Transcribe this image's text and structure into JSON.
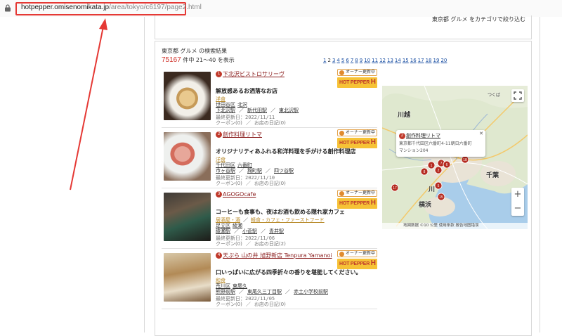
{
  "url": {
    "host": "hotpepper.omisenomikata.jp",
    "path": "/area/tokyo/c6197/page2.html"
  },
  "refine": {
    "text": "東京都 グルメ をカテゴリで絞り込む"
  },
  "results": {
    "title": "東京都 グルメ の検索結果",
    "total": "75167",
    "range_text": "件中 21〜40 を表示",
    "pager": [
      "1",
      "2",
      "3",
      "4",
      "5",
      "6",
      "7",
      "8",
      "9",
      "10",
      "11",
      "12",
      "13",
      "14",
      "15",
      "16",
      "17",
      "18",
      "19",
      "20"
    ],
    "current_page": "2"
  },
  "owner_badge": "オーナー更新中",
  "hp_logo": {
    "text": "HOT PEPPER",
    "mark": "H"
  },
  "items": [
    {
      "num": "1",
      "name": "下北沢ビストロサリーヴ",
      "catch": "解放感あるお洒落なお店",
      "genres": [
        "洋食"
      ],
      "area": [
        "世田谷区",
        "北沢"
      ],
      "stations": [
        "下北沢駅",
        "新代田駅",
        "東北沢駅"
      ],
      "updated": "最終更新日：2022/11/11",
      "coupon": "クーポン(0)",
      "diary": "お店の日記(0)"
    },
    {
      "num": "2",
      "name": "創作料理リトマ",
      "catch": "オリジナリティあふれる和洋料理を手がける創作料理店",
      "genres": [
        "洋食"
      ],
      "area": [
        "千代田区",
        "六番町"
      ],
      "stations": [
        "市ヶ谷駅",
        "麹町駅",
        "四ツ谷駅"
      ],
      "updated": "最終更新日：2022/11/10",
      "coupon": "クーポン(0)",
      "diary": "お店の日記(0)"
    },
    {
      "num": "3",
      "name": "AGOGOcafe",
      "catch": "コーヒーも食事も、夜はお酒も飲める隠れ家カフェ",
      "genres": [
        "居酒屋・酒",
        "軽食・カフェ・ファーストフード"
      ],
      "area": [
        "足立区",
        "綾瀬"
      ],
      "stations": [
        "綾瀬駅",
        "小菅駅",
        "青井駅"
      ],
      "updated": "最終更新日：2022/11/06",
      "coupon": "クーポン(0)",
      "diary": "お店の日記(2)"
    },
    {
      "num": "4",
      "name": "天ぷら 山の井 旭野新店 Tenpura Yamanoi",
      "catch": "口いっぱいに広がる四季折々の香りを堪能してください。",
      "genres": [
        "和食"
      ],
      "area": [
        "荒川区",
        "東尾久"
      ],
      "stations": [
        "熊野前駅",
        "東尾久三丁目駅",
        "赤土小学校前駅"
      ],
      "updated": "最終更新日：2022/11/05",
      "coupon": "クーポン(0)",
      "diary": "お店の日記(0)"
    }
  ],
  "map": {
    "popup_num": "2",
    "popup_title": "創作料理リトマ",
    "popup_addr1": "東京都千代田区六番町4-11朝日六番町",
    "popup_addr2": "マンション204",
    "labels": {
      "kawagoe": "川越",
      "kawa": "川",
      "yokohama": "横浜",
      "chiba": "千葉",
      "tsukuba": "つくば"
    },
    "zoom_in": "+",
    "zoom_out": "−",
    "footer": "地図数据 ©10 公里    使用条款  报告地图错误",
    "markers": [
      "17",
      "2",
      "1",
      "18",
      "8",
      "7",
      "6",
      "15",
      "5"
    ]
  },
  "colors": {
    "accent_red": "#d0342c",
    "link_blue": "#1a4fa3",
    "shop_link": "#8b1e1e",
    "annotation_red": "#e53935"
  }
}
